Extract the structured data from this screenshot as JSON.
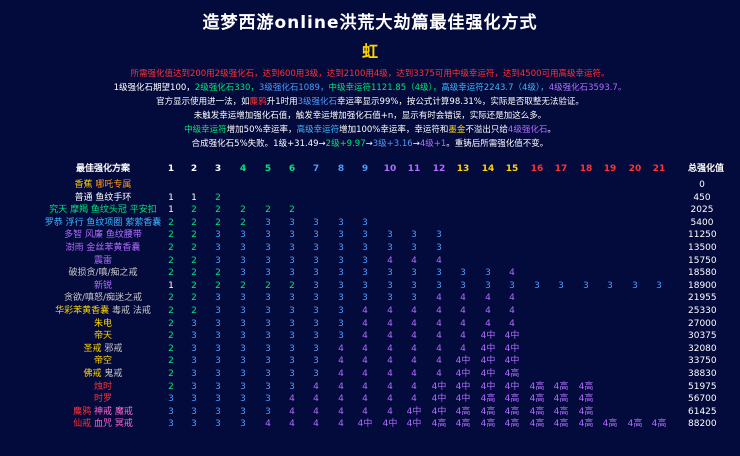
{
  "title": "造梦西游online洪荒大劫篇最佳强化方式",
  "subtitle": "虹",
  "notes": {
    "line1": "所需强化值达到200用2级强化石，达到600用3级，达到2100用4级，达到3375可用中级幸运符，达到4500可用高级幸运符。",
    "line2_a": "1级强化石期望100，",
    "line2_b": "2级强化石330，",
    "line2_c": "3级强化石1089，",
    "line2_d": "中级幸运符1121.85（4级），",
    "line2_e": "高级幸运符2243.7（4级），",
    "line2_f": "4级强化石3593.7。",
    "line3_a": "官方显示使用进一法，如",
    "line3_b": "麋鸦",
    "line3_c": "升1时用",
    "line3_d": "3级强化石",
    "line3_e": "幸运率显示99%，按公式计算98.31%，实际是否取整无法验证。",
    "line4": "未触发幸运增加强化石值，触发幸运增加强化石值+n，显示有时会错误，实际还是加这么多。",
    "line5_a": "中级幸运符",
    "line5_b": "增加50%幸运率，",
    "line5_c": "高级幸运符",
    "line5_d": "增加100%幸运率，幸运符和",
    "line5_e": "墨金",
    "line5_f": "不溢出只给",
    "line5_g": "4级强化石",
    "line5_h": "。",
    "line6_a": "合成强化石5%失败。1级+31.49→",
    "line6_b": "2级+9.97",
    "line6_c": "→",
    "line6_d": "3级+3.16",
    "line6_e": "→",
    "line6_f": "4级+1",
    "line6_g": "。重铸后所需强化值不变。"
  },
  "table": {
    "header_label": "最佳强化方案",
    "total_label": "总强化值",
    "levels": [
      "1",
      "2",
      "3",
      "4",
      "5",
      "6",
      "7",
      "8",
      "9",
      "10",
      "11",
      "12",
      "13",
      "14",
      "15",
      "16",
      "17",
      "18",
      "19",
      "20",
      "21"
    ],
    "rows": [
      {
        "names": [
          {
            "t": "香蕉",
            "c": "y"
          },
          {
            "t": " 哪吒专属",
            "c": "o"
          }
        ],
        "cells": [],
        "total": "0"
      },
      {
        "names": [
          {
            "t": "普通 鱼纹手环",
            "c": "w"
          }
        ],
        "cells": [
          "1",
          "1",
          "2"
        ],
        "total": "450"
      },
      {
        "names": [
          {
            "t": "究天 摩羯 鱼纹头冠 平安扣",
            "c": "g"
          }
        ],
        "cells": [
          "1",
          "2",
          "2",
          "2",
          "2",
          "2"
        ],
        "total": "2025"
      },
      {
        "names": [
          {
            "t": "罗恭 浮行 鱼纹项圈 萦萦香囊",
            "c": "cy"
          }
        ],
        "cells": [
          "2",
          "2",
          "2",
          "2",
          "3",
          "3",
          "3",
          "3",
          "3"
        ],
        "total": "5400"
      },
      {
        "names": [
          {
            "t": "多智 风廉 鱼纹腰带",
            "c": "p"
          }
        ],
        "cells": [
          "2",
          "2",
          "3",
          "3",
          "3",
          "3",
          "3",
          "3",
          "3",
          "3",
          "3",
          "3"
        ],
        "total": "11250"
      },
      {
        "names": [
          {
            "t": "澍雨 金丝苯黄香囊",
            "c": "p"
          }
        ],
        "cells": [
          "2",
          "2",
          "3",
          "3",
          "3",
          "3",
          "3",
          "3",
          "3",
          "3",
          "3",
          "3"
        ],
        "total": "13500"
      },
      {
        "names": [
          {
            "t": "震雷",
            "c": "p"
          }
        ],
        "cells": [
          "2",
          "2",
          "3",
          "3",
          "3",
          "3",
          "3",
          "3",
          "3",
          "4",
          "4",
          "4"
        ],
        "total": "15750"
      },
      {
        "names": [
          {
            "t": "破损贪/嗔/痴之戒",
            "c": "gy"
          }
        ],
        "cells": [
          "2",
          "2",
          "2",
          "3",
          "3",
          "3",
          "3",
          "3",
          "3",
          "3",
          "3",
          "3",
          "3",
          "3",
          "4"
        ],
        "total": "18580"
      },
      {
        "names": [
          {
            "t": "新锐",
            "c": "p"
          }
        ],
        "cells": [
          "1",
          "2",
          "2",
          "2",
          "2",
          "2",
          "3",
          "3",
          "3",
          "3",
          "3",
          "3",
          "3",
          "3",
          "3",
          "3",
          "3",
          "3",
          "3",
          "3",
          "3"
        ],
        "total": "18900"
      },
      {
        "names": [
          {
            "t": "贪欲/嗔怒/痴迷之戒",
            "c": "gy"
          }
        ],
        "cells": [
          "2",
          "2",
          "3",
          "3",
          "3",
          "3",
          "3",
          "3",
          "3",
          "3",
          "3",
          "4",
          "4",
          "4",
          "4"
        ],
        "total": "21955"
      },
      {
        "names": [
          {
            "t": "华彩苯黄香囊",
            "c": "y"
          },
          {
            "t": " 毒戒 法戒",
            "c": "gy"
          }
        ],
        "cells": [
          "2",
          "2",
          "3",
          "3",
          "3",
          "3",
          "3",
          "3",
          "4",
          "4",
          "4",
          "4",
          "4",
          "4",
          "4"
        ],
        "total": "25330"
      },
      {
        "names": [
          {
            "t": "朱电",
            "c": "y"
          }
        ],
        "cells": [
          "2",
          "3",
          "3",
          "3",
          "3",
          "3",
          "3",
          "3",
          "4",
          "4",
          "4",
          "4",
          "4",
          "4",
          "4"
        ],
        "total": "27000"
      },
      {
        "names": [
          {
            "t": "帝天",
            "c": "y"
          }
        ],
        "cells": [
          "2",
          "3",
          "3",
          "3",
          "3",
          "3",
          "3",
          "3",
          "4",
          "4",
          "4",
          "4",
          "4",
          "4中",
          "4中"
        ],
        "total": "30375"
      },
      {
        "names": [
          {
            "t": "圣戒",
            "c": "y"
          },
          {
            "t": " 邪戒",
            "c": "gy"
          }
        ],
        "cells": [
          "2",
          "3",
          "3",
          "3",
          "3",
          "3",
          "3",
          "4",
          "4",
          "4",
          "4",
          "4",
          "4",
          "4中",
          "4中"
        ],
        "total": "32080"
      },
      {
        "names": [
          {
            "t": "帝空",
            "c": "y"
          }
        ],
        "cells": [
          "2",
          "3",
          "3",
          "3",
          "3",
          "3",
          "3",
          "4",
          "4",
          "4",
          "4",
          "4",
          "4中",
          "4中",
          "4中"
        ],
        "total": "33750"
      },
      {
        "names": [
          {
            "t": "佛戒",
            "c": "y"
          },
          {
            "t": " 鬼戒",
            "c": "gy"
          }
        ],
        "cells": [
          "2",
          "3",
          "3",
          "3",
          "3",
          "3",
          "3",
          "4",
          "4",
          "4",
          "4",
          "4",
          "4中",
          "4中",
          "4高"
        ],
        "total": "38830"
      },
      {
        "names": [
          {
            "t": "烛时",
            "c": "r"
          }
        ],
        "cells": [
          "2",
          "3",
          "3",
          "3",
          "3",
          "3",
          "4",
          "4",
          "4",
          "4",
          "4",
          "4中",
          "4中",
          "4中",
          "4中",
          "4高",
          "4高",
          "4高"
        ],
        "total": "51975"
      },
      {
        "names": [
          {
            "t": "时罗",
            "c": "r"
          }
        ],
        "cells": [
          "3",
          "3",
          "3",
          "3",
          "3",
          "4",
          "4",
          "4",
          "4",
          "4",
          "4",
          "4中",
          "4中",
          "4高",
          "4高",
          "4高",
          "4高",
          "4高"
        ],
        "total": "56700"
      },
      {
        "names": [
          {
            "t": "麋鸦",
            "c": "r"
          },
          {
            "t": " 神戒 魔戒",
            "c": "pk"
          }
        ],
        "cells": [
          "3",
          "3",
          "3",
          "3",
          "3",
          "4",
          "4",
          "4",
          "4",
          "4",
          "4中",
          "4中",
          "4高",
          "4高",
          "4高",
          "4高",
          "4高",
          "4高"
        ],
        "total": "61425"
      },
      {
        "names": [
          {
            "t": "仙戒",
            "c": "r"
          },
          {
            "t": " 血咒 冥戒",
            "c": "pk"
          }
        ],
        "cells": [
          "3",
          "3",
          "3",
          "3",
          "4",
          "4",
          "4",
          "4",
          "4中",
          "4中",
          "4中",
          "4高",
          "4高",
          "4高",
          "4高",
          "4高",
          "4高",
          "4高",
          "4高",
          "4高",
          "4高"
        ],
        "total": "88200"
      }
    ]
  }
}
